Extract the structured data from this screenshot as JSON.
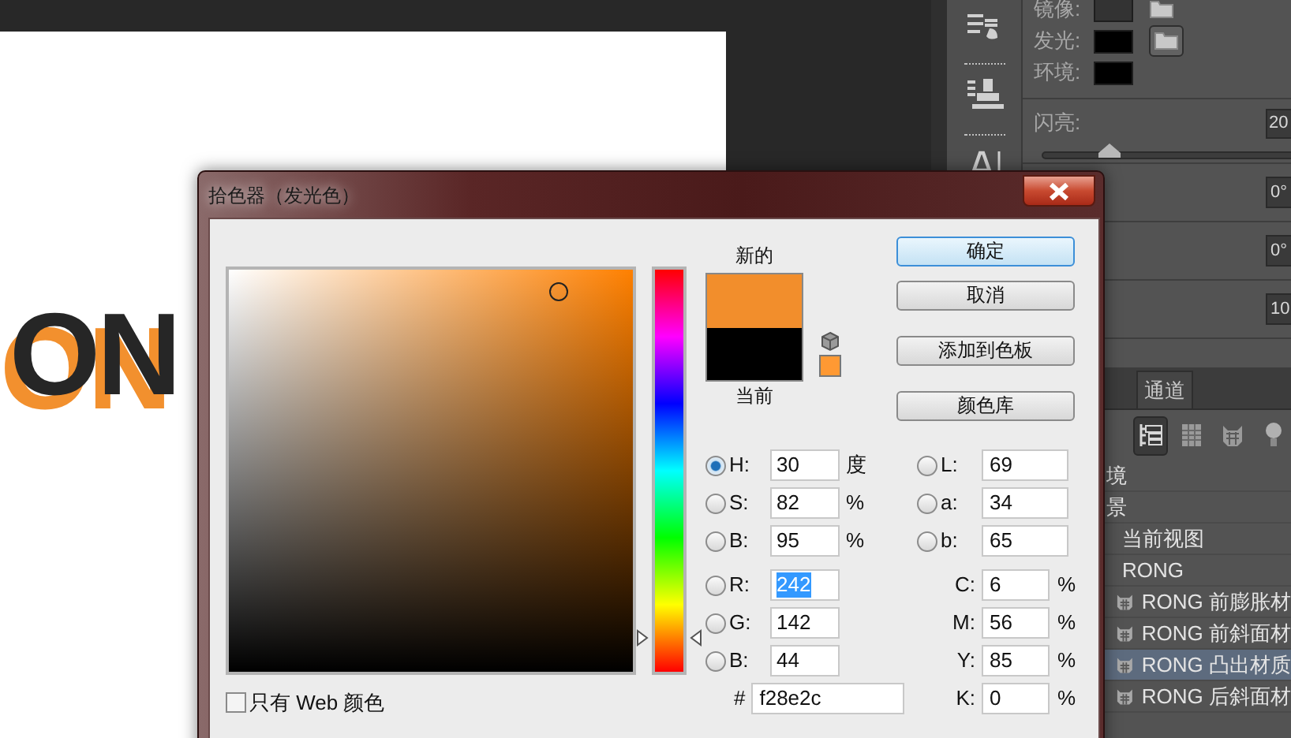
{
  "canvas": {
    "artwork_text": "ON"
  },
  "properties": {
    "maps": [
      {
        "label": "镜像:",
        "color": "#333333",
        "kind": "folder"
      },
      {
        "label": "发光:",
        "color": "#000000",
        "kind": "button"
      },
      {
        "label": "环境:",
        "color": "#000000",
        "kind": "bare"
      }
    ],
    "shine": {
      "label": "闪亮:",
      "value": "20",
      "level": 0.27
    },
    "value_boxes": [
      "0°",
      "0°",
      "10"
    ],
    "tabs": [
      {
        "label": "通道",
        "selected": false
      }
    ],
    "view_buttons": [
      {
        "kind": "scene",
        "selected": true
      },
      {
        "kind": "table",
        "selected": false
      },
      {
        "kind": "mesh",
        "selected": false
      },
      {
        "kind": "light",
        "selected": false
      }
    ],
    "tree": [
      {
        "label": "境",
        "selected": false
      },
      {
        "label": "景",
        "selected": false,
        "children": [
          {
            "label": "当前视图",
            "selected": false
          },
          {
            "label": "RONG",
            "selected": false,
            "children": [
              {
                "label": "RONG 前膨胀材",
                "selected": false
              },
              {
                "label": "RONG 前斜面材",
                "selected": false
              },
              {
                "label": "RONG 凸出材质",
                "selected": true
              },
              {
                "label": "RONG 后斜面材",
                "selected": false
              }
            ]
          }
        ]
      }
    ]
  },
  "dialog": {
    "title": "拾色器（发光色）",
    "hue_slider": {
      "level": 0.083
    },
    "web_only": {
      "label": "只有 Web 颜色",
      "checked": false
    },
    "swatches": [
      {
        "label": "新的",
        "color": "#f28e2c"
      },
      {
        "label": "当前",
        "color": "#000000"
      }
    ],
    "web_safe": {
      "color": "#ff9933"
    },
    "buttons": [
      {
        "label": "确定",
        "default": true
      },
      {
        "label": "取消",
        "default": false
      },
      {
        "label": "添加到色板",
        "default": false
      },
      {
        "label": "颜色库",
        "default": false
      }
    ],
    "fields_left": [
      {
        "kind": "radio",
        "label": "H:",
        "value": "30",
        "unit": "度",
        "selected": true,
        "text_selected": false
      },
      {
        "kind": "radio",
        "label": "S:",
        "value": "82",
        "unit": "%",
        "selected": false,
        "text_selected": false
      },
      {
        "kind": "radio",
        "label": "B:",
        "value": "95",
        "unit": "%",
        "selected": false,
        "text_selected": false
      },
      {
        "kind": "radio",
        "label": "R:",
        "value": "242",
        "selected": false,
        "text_selected": true
      },
      {
        "kind": "radio",
        "label": "G:",
        "value": "142",
        "selected": false,
        "text_selected": false
      },
      {
        "kind": "radio",
        "label": "B:",
        "value": "44",
        "selected": false,
        "text_selected": false
      }
    ],
    "hex": {
      "label": "#",
      "value": "f28e2c"
    },
    "fields_right": [
      {
        "kind": "radio",
        "label": "L:",
        "value": "69",
        "selected": false
      },
      {
        "kind": "radio",
        "label": "a:",
        "value": "34",
        "selected": false
      },
      {
        "kind": "radio",
        "label": "b:",
        "value": "65",
        "selected": false
      },
      {
        "kind": "plain",
        "label": "C:",
        "value": "6",
        "unit": "%"
      },
      {
        "kind": "plain",
        "label": "M:",
        "value": "56",
        "unit": "%"
      },
      {
        "kind": "plain",
        "label": "Y:",
        "value": "85",
        "unit": "%"
      },
      {
        "kind": "plain",
        "label": "K:",
        "value": "0",
        "unit": "%"
      }
    ]
  }
}
